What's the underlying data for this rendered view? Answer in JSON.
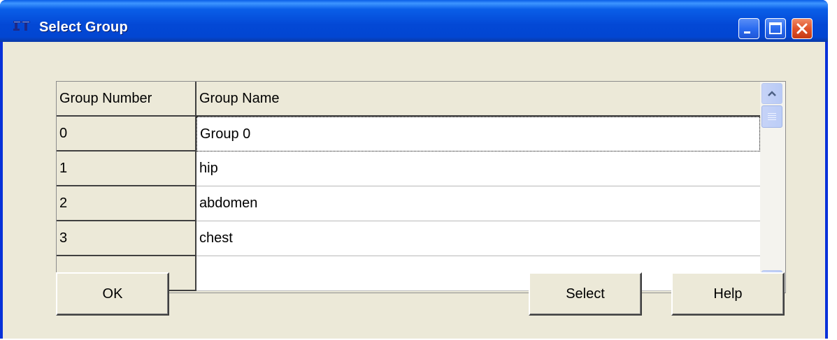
{
  "window": {
    "title": "Select Group",
    "titlebar_color": "#0a5ee8",
    "client_background": "#ece9d8",
    "controls": [
      "minimize-icon",
      "maximize-icon",
      "close-icon"
    ]
  },
  "grid": {
    "columns": [
      "Group Number",
      "Group Name"
    ],
    "rows": [
      {
        "number": "0",
        "name": "Group 0"
      },
      {
        "number": "1",
        "name": "hip"
      },
      {
        "number": "2",
        "name": "abdomen"
      },
      {
        "number": "3",
        "name": "chest"
      }
    ],
    "selected_row": 0
  },
  "buttons": {
    "ok": "OK",
    "select": "Select",
    "help": "Help"
  }
}
